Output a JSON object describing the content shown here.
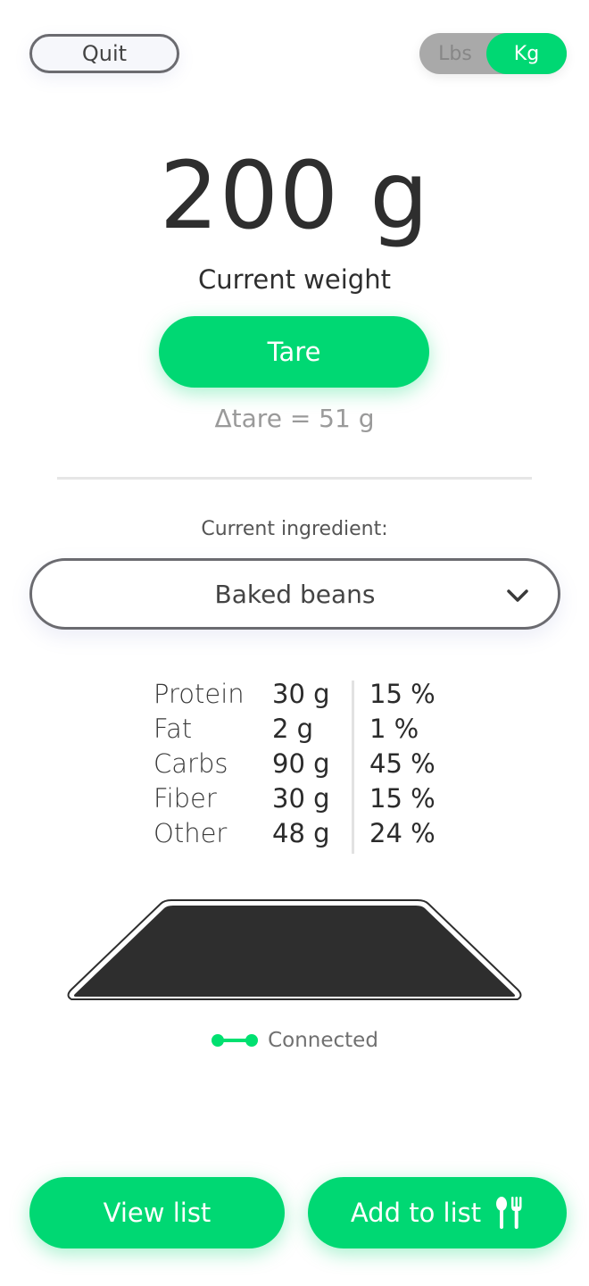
{
  "header": {
    "quit_label": "Quit",
    "unit_toggle": {
      "options": [
        "Lbs",
        "Kg"
      ],
      "selected": "Kg"
    }
  },
  "weight": {
    "value": "200 g",
    "label": "Current weight",
    "tare_label": "Tare",
    "tare_delta": "Δtare = 51 g"
  },
  "ingredient": {
    "label": "Current ingredient:",
    "selected": "Baked beans",
    "dropdown_icon": "chevron-down-icon"
  },
  "nutrition": [
    {
      "name": "Protein",
      "amount": "30 g",
      "percent": "15 %"
    },
    {
      "name": "Fat",
      "amount": "2 g",
      "percent": "1 %"
    },
    {
      "name": "Carbs",
      "amount": "90 g",
      "percent": "45 %"
    },
    {
      "name": "Fiber",
      "amount": "30 g",
      "percent": "15 %"
    },
    {
      "name": "Other",
      "amount": "48 g",
      "percent": "24 %"
    }
  ],
  "status": {
    "text": "Connected",
    "icon": "connected-icon",
    "color": "#00e070"
  },
  "actions": {
    "view_list_label": "View list",
    "add_to_list_label": "Add to list",
    "add_icon": "utensils-icon"
  },
  "colors": {
    "accent": "#00d873",
    "text": "#2e2e2e",
    "muted": "#9a9a9a",
    "scale_top": "#2e2e2e"
  }
}
